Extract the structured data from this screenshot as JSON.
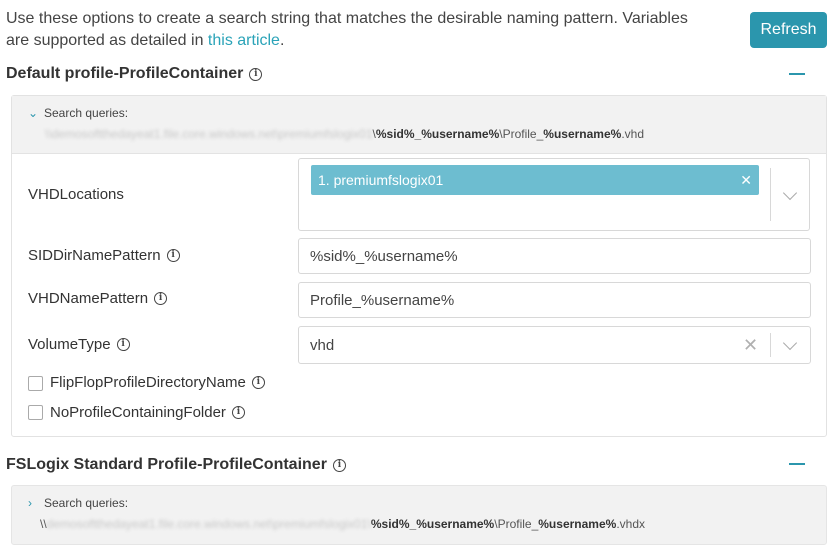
{
  "intro": {
    "text_before": "Use these options to create a search string that matches the desirable naming pattern. Variables are supported as detailed in ",
    "link_text": "this article",
    "text_after": "."
  },
  "refresh_label": "Refresh",
  "sections": [
    {
      "title": "Default profile-ProfileContainer",
      "queries_label": "Search queries:",
      "query": {
        "prefix": "\\\\",
        "blurred": "\\\\demosoftthedayeat1.file.core.windows.net\\premiumfslogix01",
        "bold1": "%sid%_%username%",
        "mid": "\\Profile_",
        "bold2": "%username%",
        "suffix": ".vhd"
      },
      "fields": {
        "vhd_locations": {
          "label": "VHDLocations",
          "chip": "1. premiumfslogix01"
        },
        "sid_dir_name_pattern": {
          "label": "SIDDirNamePattern",
          "value": "%sid%_%username%"
        },
        "vhd_name_pattern": {
          "label": "VHDNamePattern",
          "value": "Profile_%username%"
        },
        "volume_type": {
          "label": "VolumeType",
          "value": "vhd"
        }
      },
      "checkboxes": {
        "flip_flop": "FlipFlopProfileDirectoryName",
        "no_profile_folder": "NoProfileContainingFolder"
      }
    },
    {
      "title": "FSLogix Standard Profile-ProfileContainer",
      "queries_label": "Search queries:",
      "query": {
        "prefix": "\\\\",
        "blurred": "demosoftthedayeat1.file.core.windows.net\\premiumfslogix01\\",
        "bold1": "%sid%_%username%",
        "mid": "\\Profile_",
        "bold2": "%username%",
        "suffix": ".vhdx"
      }
    }
  ],
  "colors": {
    "accent": "#2b96ad",
    "link": "#2aa3b8",
    "chip": "#6dbdd0",
    "panel_bg": "#f2f2f2"
  }
}
